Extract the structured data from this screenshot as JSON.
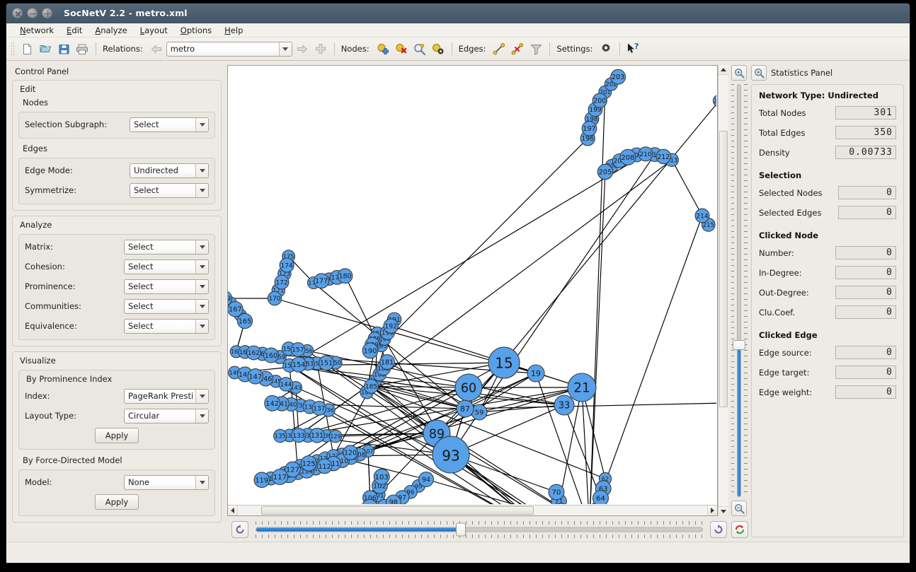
{
  "window": {
    "title": "SocNetV 2.2 - metro.xml",
    "buttons": {
      "close": "close-window",
      "minimize": "minimize-window",
      "maximize": "maximize-window"
    }
  },
  "menubar": {
    "items": [
      {
        "mnemonic": "N",
        "rest": "etwork"
      },
      {
        "mnemonic": "E",
        "rest": "dit"
      },
      {
        "mnemonic": "A",
        "rest": "nalyze"
      },
      {
        "mnemonic": "L",
        "rest": "ayout"
      },
      {
        "mnemonic": "O",
        "rest": "ptions"
      },
      {
        "mnemonic": "H",
        "rest": "elp"
      }
    ]
  },
  "toolbar": {
    "relations_label": "Relations:",
    "relations_value": "metro",
    "nodes_label": "Nodes:",
    "edges_label": "Edges:",
    "settings_label": "Settings:",
    "icons": [
      "new-file-icon",
      "open-file-icon",
      "save-file-icon",
      "print-icon",
      "previous-relation-icon",
      "next-relation-icon",
      "add-relation-icon",
      "add-node-icon",
      "remove-node-icon",
      "find-node-icon",
      "node-properties-icon",
      "add-edge-icon",
      "remove-edge-icon",
      "filter-edges-icon",
      "settings-gear-icon",
      "whats-this-icon"
    ]
  },
  "control_panel": {
    "title": "Control Panel",
    "edit": {
      "title": "Edit",
      "nodes": {
        "title": "Nodes",
        "rows": [
          {
            "label": "Selection Subgraph:",
            "value": "Select"
          }
        ]
      },
      "edges": {
        "title": "Edges",
        "rows": [
          {
            "label": "Edge Mode:",
            "value": "Undirected"
          },
          {
            "label": "Symmetrize:",
            "value": "Select"
          }
        ]
      }
    },
    "analyze": {
      "title": "Analyze",
      "rows": [
        {
          "label": "Matrix:",
          "value": "Select"
        },
        {
          "label": "Cohesion:",
          "value": "Select"
        },
        {
          "label": "Prominence:",
          "value": "Select"
        },
        {
          "label": "Communities:",
          "value": "Select"
        },
        {
          "label": "Equivalence:",
          "value": "Select"
        }
      ]
    },
    "visualize": {
      "title": "Visualize",
      "by_prominence": {
        "title": "By Prominence Index",
        "rows": [
          {
            "label": "Index:",
            "value": "PageRank Presti"
          },
          {
            "label": "Layout Type:",
            "value": "Circular"
          }
        ],
        "apply_label": "Apply"
      },
      "by_force": {
        "title": "By Force-Directed Model",
        "rows": [
          {
            "label": "Model:",
            "value": "None"
          }
        ],
        "apply_label": "Apply"
      }
    }
  },
  "statistics_panel": {
    "title": "Statistics Panel",
    "network_type_label": "Network Type:",
    "network_type_value": "Undirected",
    "network_rows": [
      {
        "label": "Total Nodes",
        "value": "301"
      },
      {
        "label": "Total Edges",
        "value": "350"
      },
      {
        "label": "Density",
        "value": "0.00733"
      }
    ],
    "selection_title": "Selection",
    "selection_rows": [
      {
        "label": "Selected Nodes",
        "value": "0"
      },
      {
        "label": "Selected Edges",
        "value": "0"
      }
    ],
    "clicked_node_title": "Clicked Node",
    "clicked_node_rows": [
      {
        "label": "Number:",
        "value": "0"
      },
      {
        "label": "In-Degree:",
        "value": "0"
      },
      {
        "label": "Out-Degree:",
        "value": "0"
      },
      {
        "label": "Clu.Coef.",
        "value": "0"
      }
    ],
    "clicked_edge_title": "Clicked Edge",
    "clicked_edge_rows": [
      {
        "label": "Edge source:",
        "value": "0"
      },
      {
        "label": "Edge target:",
        "value": "0"
      },
      {
        "label": "Edge weight:",
        "value": "0"
      }
    ]
  },
  "graph": {
    "node_fill": "#57a0ea",
    "node_stroke": "#3a3a3a",
    "edge_color": "#000000",
    "background": "#ffffff",
    "label_color": "#1a1a1a",
    "total_nodes_drawn": 301
  },
  "zoom_controls": {
    "zoom_in_icon": "zoom-in-icon",
    "zoom_out_icon": "zoom-out-icon",
    "vertical_slider_value": 38,
    "horizontal_slider_value": 46,
    "rotate_left_icon": "rotate-left-icon",
    "rotate_right_icon": "rotate-right-icon",
    "reset_layout_icon": "reset-layout-icon"
  },
  "scrollbars": {
    "vertical_thumb_top_pct": 13,
    "vertical_thumb_height_pct": 64,
    "horizontal_thumb_left_pct": 5,
    "horizontal_thumb_width_pct": 58
  }
}
